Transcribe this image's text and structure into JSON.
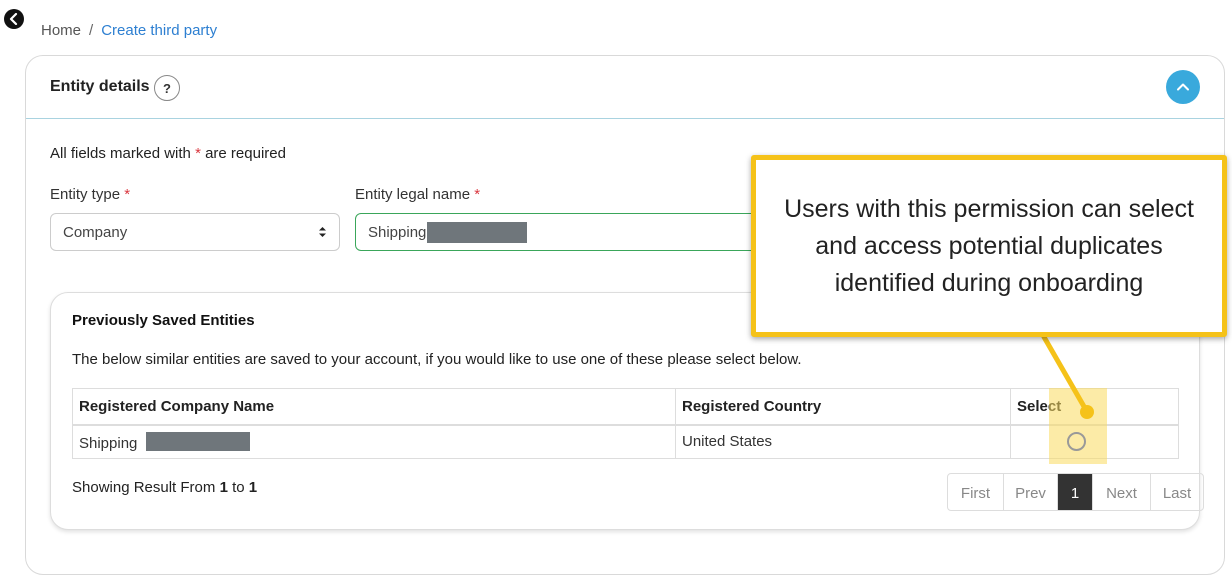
{
  "breadcrumb": {
    "home": "Home",
    "separator": "/",
    "current": "Create third party"
  },
  "header": {
    "title": "Entity details",
    "help_icon": "?"
  },
  "form": {
    "required_note_prefix": "All fields marked with",
    "required_mark": "*",
    "required_note_suffix": "are required",
    "entity_type": {
      "label": "Entity type",
      "value": "Company"
    },
    "entity_legal_name": {
      "label": "Entity legal name",
      "value": "Shipping"
    }
  },
  "saved_entities": {
    "title": "Previously Saved Entities",
    "description": "The below similar entities are saved to your account, if you would like to use one of these please select below.",
    "columns": [
      "Registered Company Name",
      "Registered Country",
      "Select"
    ],
    "rows": [
      {
        "name": "Shipping",
        "country": "United States",
        "selected": false
      }
    ],
    "showing_prefix": "Showing Result From",
    "showing_from": "1",
    "showing_to_word": "to",
    "showing_to": "1"
  },
  "pagination": {
    "first": "First",
    "prev": "Prev",
    "current": "1",
    "next": "Next",
    "last": "Last"
  },
  "callout": {
    "text": "Users with this permission can select and access potential duplicates identified during onboarding"
  },
  "colors": {
    "accent": "#39a9dc",
    "link": "#2d7fd1",
    "callout_border": "#f5c219",
    "required": "#d9363e",
    "valid_border": "#3aa65a"
  }
}
